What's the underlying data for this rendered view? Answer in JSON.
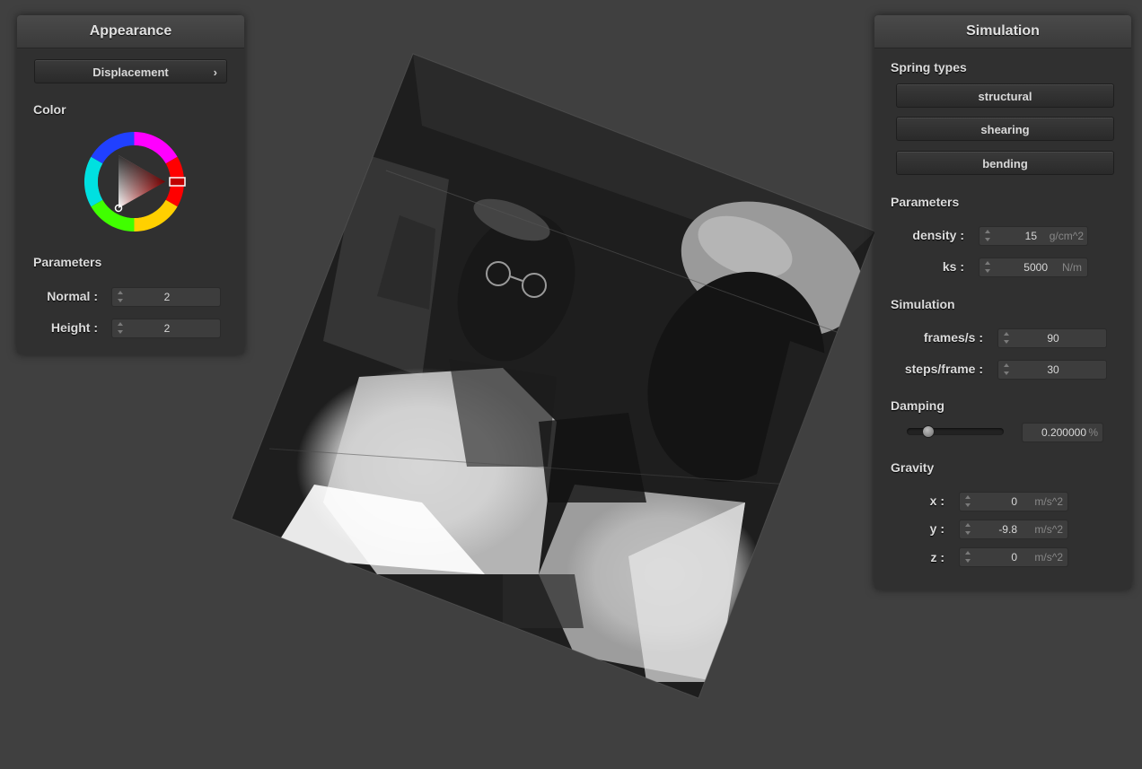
{
  "appearance": {
    "title": "Appearance",
    "mode_button": "Displacement",
    "mode_chevron": "›",
    "color_label": "Color",
    "color_value": "#c00000",
    "parameters_label": "Parameters",
    "normal_label": "Normal :",
    "normal_value": "2",
    "height_label": "Height :",
    "height_value": "2"
  },
  "simulation": {
    "title": "Simulation",
    "spring_types_label": "Spring types",
    "spring_buttons": [
      "structural",
      "shearing",
      "bending"
    ],
    "parameters_label": "Parameters",
    "density_label": "density :",
    "density_value": "15",
    "density_unit": "g/cm^2",
    "ks_label": "ks :",
    "ks_value": "5000",
    "ks_unit": "N/m",
    "simulation_label": "Simulation",
    "fps_label": "frames/s :",
    "fps_value": "90",
    "steps_label": "steps/frame :",
    "steps_value": "30",
    "damping_label": "Damping",
    "damping_slider": 0.2,
    "damping_value": "0.200000",
    "damping_unit": "%",
    "gravity_label": "Gravity",
    "gx_label": "x :",
    "gx_value": "0",
    "gy_label": "y :",
    "gy_value": "-9.8",
    "gz_label": "z :",
    "gz_value": "0",
    "gravity_unit": "m/s^2"
  },
  "colors": {
    "background": "#404040",
    "panel": "#303030",
    "accent_red": "#c00000"
  }
}
